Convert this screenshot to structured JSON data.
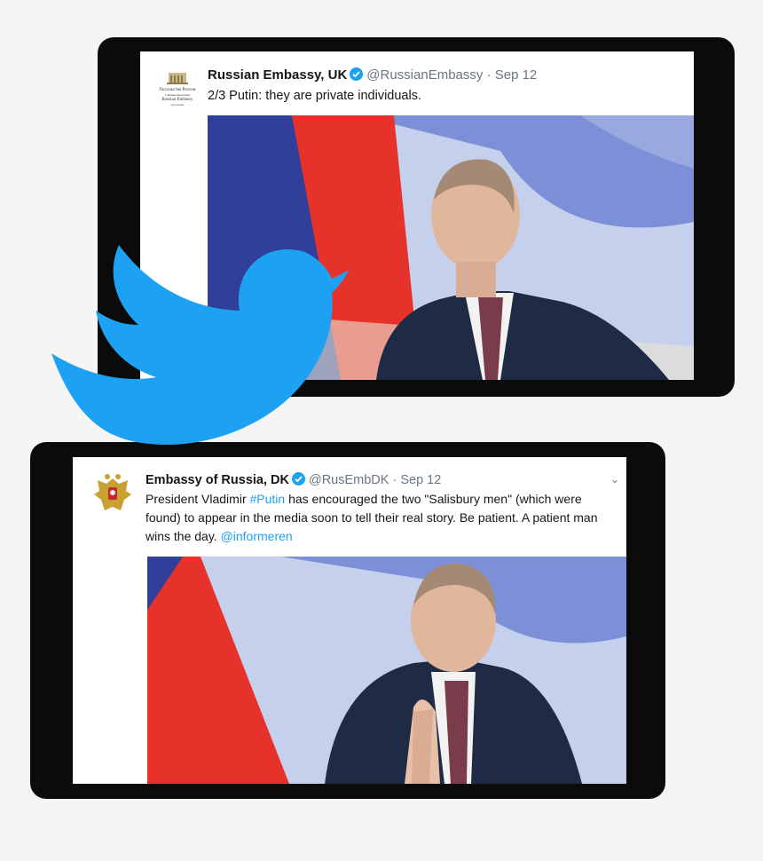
{
  "tweets": [
    {
      "display_name": "Russian Embassy, UK",
      "handle": "@RussianEmbassy",
      "date": "Sep 12",
      "text": "2/3 Putin: they are private individuals.",
      "avatar_lines": [
        "Посольство России",
        "в Великобритании",
        "Russian Embassy",
        "in London"
      ]
    },
    {
      "display_name": "Embassy of Russia, DK",
      "handle": "@RusEmbDK",
      "date": "Sep 12",
      "text_parts": {
        "before_hashtag": "President Vladimir ",
        "hashtag": "#Putin",
        "after_hashtag": " has encouraged the two \"Salisbury men\" (which were found) to appear in the media soon to tell their real story. Be patient. A patient man wins the day. ",
        "mention": "@informeren"
      }
    }
  ],
  "icons": {
    "verified": "verified-badge-icon",
    "bird": "twitter-bird-icon",
    "caret": "chevron-down-icon"
  },
  "colors": {
    "twitter_blue": "#1da1f2",
    "flag_red": "#e6322a",
    "flag_blue": "#2f3f9a",
    "background": "#f5f5f5"
  }
}
